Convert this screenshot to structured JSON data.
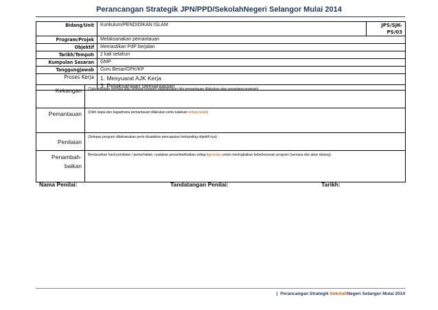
{
  "title": "Perancangan Strategik  JPN/PPD/SekolahNegeri Selangor Mulai 2014",
  "info": {
    "code": "JPS/SJK-PS/03",
    "rows": [
      {
        "label": "Bidang/Unit",
        "value": "Kurikulum/PENDIDIKAN  ISLAM"
      },
      {
        "label": "Program/Projek",
        "value": "Melaksanakan  pemantauan"
      },
      {
        "label": "Objektif",
        "value": "Memastikan PdP  berjalan"
      },
      {
        "label": "Tarikh/Tempoh",
        "value": "2 kali setahun"
      },
      {
        "label": "Kumpulan Sasaran",
        "value": "GMP"
      },
      {
        "label": "Tanggungjawab",
        "value": "Guru Besar/GPK/KP"
      }
    ],
    "process_label": "Proses  Kerja",
    "process_items": [
      "1. Mesyuarat AJK Kerja",
      "3. Pelaksanaan  pemantauan"
    ]
  },
  "evaluation": [
    {
      "label": "Kekangan",
      "desc_before": "(Tulis  masalah semasa atau selepas program dilaksanakan bila pemantauan dilakukan atau sepanjang program)",
      "highlight": "",
      "desc_after": ""
    },
    {
      "label": "Pemantauan",
      "desc_before": "(Oleh siapa dan bagaimana pemantauan dilakukan serta tulaksan ",
      "highlight": "setiap bulan",
      "desc_after": ")"
    },
    {
      "label": "Penilaian",
      "desc_before": "(Selepas  program dilaksanakan perlu dicatatkan  pencapaian  berbanding objektif nya)",
      "highlight": "",
      "desc_after": ""
    },
    {
      "label": "Penambah-\nbaikan",
      "desc_before": "Berdasarkan hasil pemilaian / pemerhatian, nyatakan penambahbaikan setiap ",
      "highlight": "tiga bulan",
      "desc_after": " untuk meningkatkan keberkesanan program (semasa dan akan datang)."
    }
  ],
  "signature": {
    "assessor_name": "Nama Penilai:",
    "assessor_signature": "Tandatangan Penilai:",
    "date": "Tarikh:"
  },
  "footer": {
    "separator": "|",
    "text_before": "Perancangan Strategik ",
    "highlight": "Sekolah",
    "text_after": "Negeri Selangor Mulai 2014"
  }
}
